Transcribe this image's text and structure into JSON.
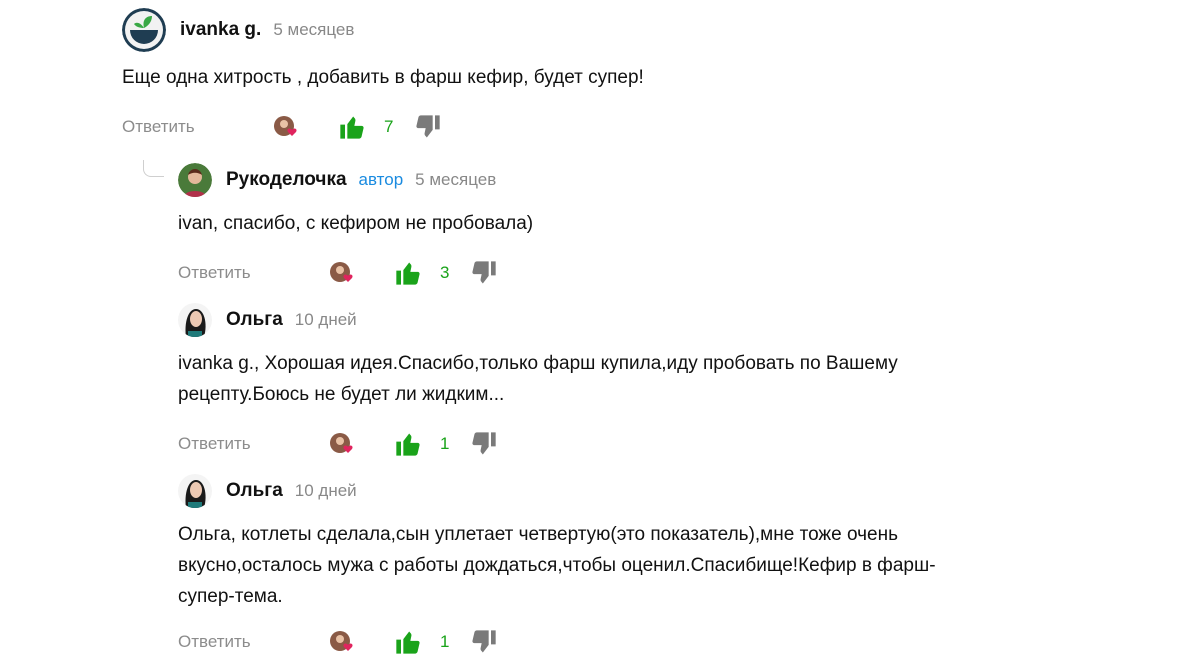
{
  "colors": {
    "accent_like": "#1aa31a",
    "author_badge": "#1a8be0",
    "muted": "#8c8c8c"
  },
  "comments": [
    {
      "author": "ivanka g.",
      "badge": "",
      "time": "5 месяцев",
      "text": "Еще одна хитрость , добавить в фарш кефир, будет супер!",
      "reply_label": "Ответить",
      "likes": "7",
      "avatar_icon": "bowl-avatar-icon"
    },
    {
      "author": "Рукоделочка",
      "badge": "автор",
      "time": "5 месяцев",
      "text": "ivan, спасибо, с кефиром не пробовала)",
      "reply_label": "Ответить",
      "likes": "3",
      "avatar_icon": "user-photo-avatar"
    },
    {
      "author": "Ольга",
      "badge": "",
      "time": "10 дней",
      "text": "ivanka g., Хорошая идея.Спасибо,только фарш купила,иду пробовать по Вашему рецепту.Боюсь не будет ли жидким...",
      "reply_label": "Ответить",
      "likes": "1",
      "avatar_icon": "user-photo-avatar"
    },
    {
      "author": "Ольга",
      "badge": "",
      "time": "10 дней",
      "text": "Ольга, котлеты сделала,сын уплетает четвертую(это показатель),мне тоже очень вкусно,осталось мужа с работы дождаться,чтобы оценил.Спасибище!Кефир в фарш- супер-тема.",
      "reply_label": "Ответить",
      "likes": "1",
      "avatar_icon": "user-photo-avatar"
    }
  ]
}
